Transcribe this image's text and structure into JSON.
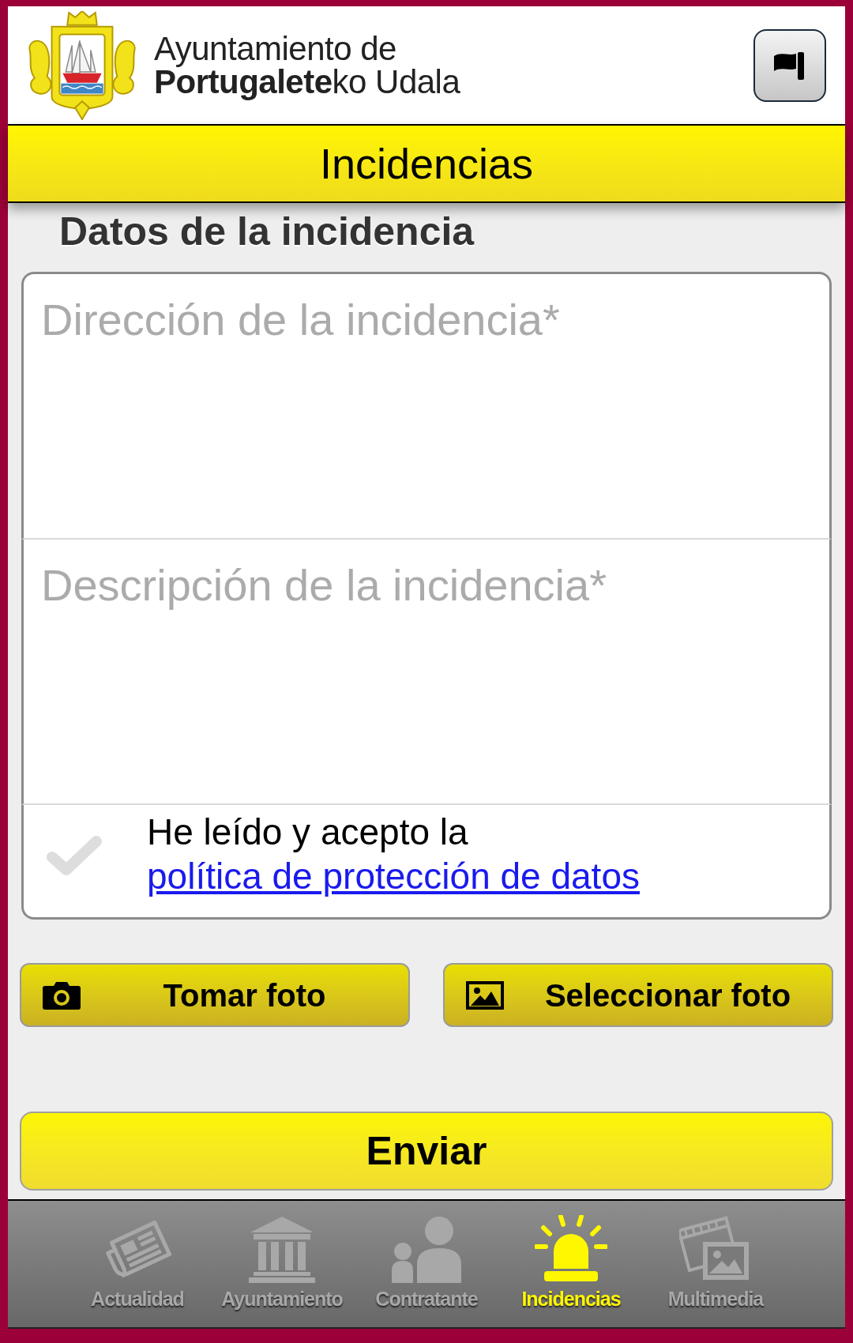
{
  "header": {
    "logo_text": [
      "Ayuntamiento de",
      "**Portugalete**ko Udala"
    ]
  },
  "title_bar": {
    "title": "Incidencias"
  },
  "form": {
    "heading": "Datos de la incidencia",
    "fields": [
      {
        "placeholder": "Dirección de la incidencia*"
      },
      {
        "placeholder": "Descripción de la incidencia*"
      }
    ],
    "consent": {
      "text": "He leído y acepto la",
      "link": "política de protección de datos",
      "checked": false
    }
  },
  "photo_buttons": [
    {
      "kind": "camera",
      "label": "Tomar foto"
    },
    {
      "kind": "gallery",
      "label": "Seleccionar foto"
    }
  ],
  "submit_button": {
    "label": "Enviar"
  },
  "tab_bar": [
    {
      "kind": "news",
      "label": "Actualidad",
      "selected": false
    },
    {
      "kind": "townhall",
      "label": "Ayuntamiento",
      "selected": false
    },
    {
      "kind": "people",
      "label": "Contratante",
      "selected": false
    },
    {
      "kind": "alert",
      "label": "Incidencias",
      "selected": true
    },
    {
      "kind": "media",
      "label": "Multimedia",
      "selected": false
    }
  ]
}
